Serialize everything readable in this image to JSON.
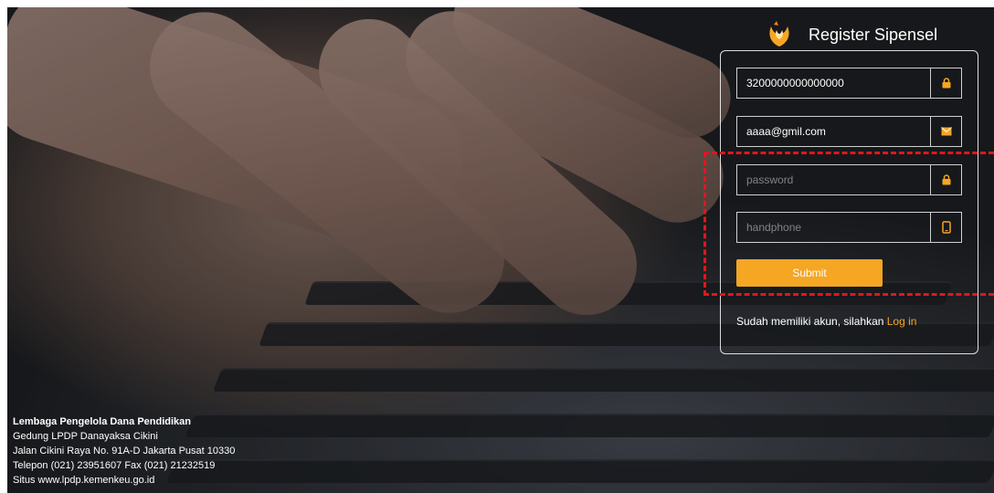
{
  "brand": {
    "title": "Register Sipensel",
    "logo_icon": "flame-logo-icon"
  },
  "form": {
    "nik_value": "3200000000000000",
    "email_value": "aaaa@gmil.com",
    "password_placeholder": "password",
    "phone_placeholder": "handphone",
    "submit_label": "Submit"
  },
  "login": {
    "prompt": "Sudah memiliki akun, silahkan ",
    "link": "Log in"
  },
  "footer": {
    "org": "Lembaga Pengelola Dana Pendidikan",
    "line1": "Gedung LPDP Danayaksa Cikini",
    "line2": "Jalan Cikini Raya No. 91A-D Jakarta Pusat 10330",
    "line3": "Telepon (021) 23951607 Fax (021) 21232519",
    "line4": "Situs www.lpdp.kemenkeu.go.id"
  },
  "colors": {
    "accent": "#f5a623",
    "highlight": "#e0161e"
  },
  "icons": [
    "lock-icon",
    "envelope-icon",
    "lock-icon",
    "phone-icon"
  ]
}
